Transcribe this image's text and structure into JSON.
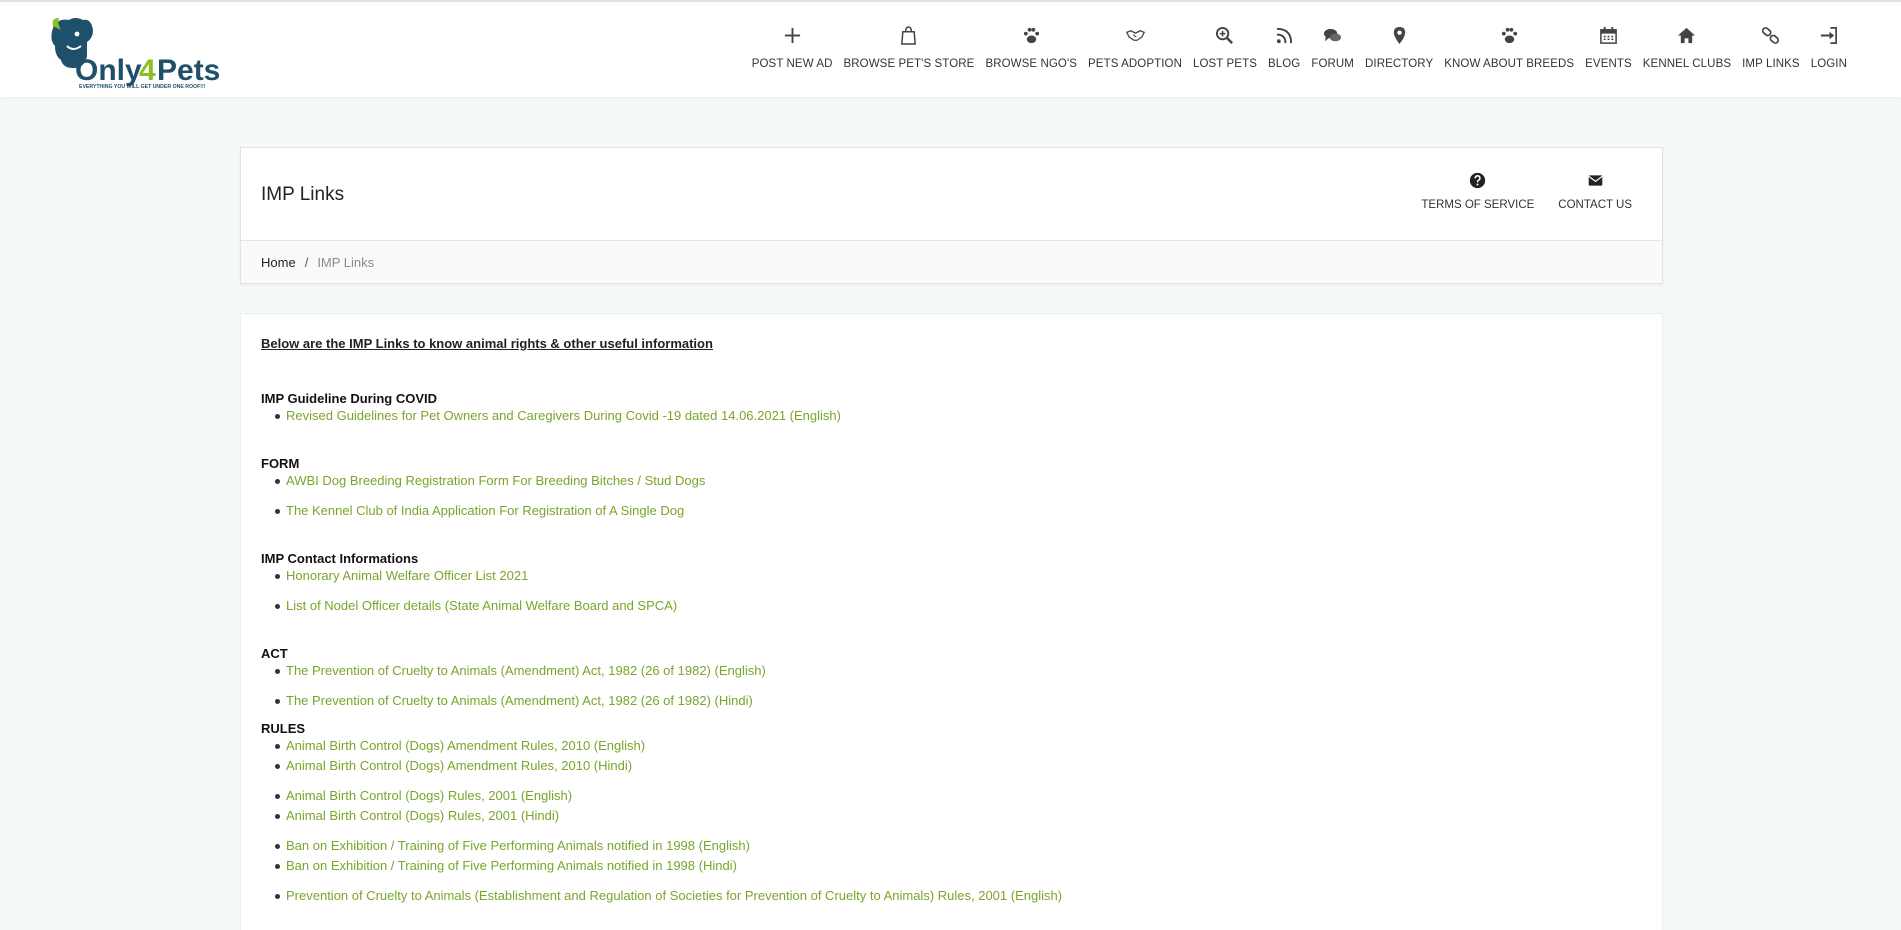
{
  "logo": {
    "brand": "Only4Pets",
    "tagline": "EVERYTHING YOU WILL GET UNDER ONE ROOF!!!"
  },
  "nav": [
    {
      "label": "POST NEW AD",
      "icon": "plus-icon"
    },
    {
      "label": "BROWSE PET'S STORE",
      "icon": "shopping-bag-icon"
    },
    {
      "label": "BROWSE NGO'S",
      "icon": "paw-icon"
    },
    {
      "label": "PETS ADOPTION",
      "icon": "handshake-icon"
    },
    {
      "label": "LOST PETS",
      "icon": "search-plus-icon"
    },
    {
      "label": "BLOG",
      "icon": "rss-icon"
    },
    {
      "label": "FORUM",
      "icon": "comments-icon"
    },
    {
      "label": "DIRECTORY",
      "icon": "map-marker-icon"
    },
    {
      "label": "KNOW ABOUT BREEDS",
      "icon": "paw-icon"
    },
    {
      "label": "EVENTS",
      "icon": "calendar-icon"
    },
    {
      "label": "KENNEL CLUBS",
      "icon": "home-icon"
    },
    {
      "label": "IMP LINKS",
      "icon": "link-icon"
    },
    {
      "label": "LOGIN",
      "icon": "sign-in-icon"
    }
  ],
  "page": {
    "title": "IMP Links",
    "terms_label": "TERMS OF SERVICE",
    "contact_label": "CONTACT US"
  },
  "breadcrumb": {
    "home": "Home",
    "separator": "/",
    "current": "IMP Links"
  },
  "content": {
    "intro": "Below are the IMP Links to know animal rights & other useful information",
    "sections": [
      {
        "title": "IMP Guideline During COVID",
        "links": [
          "Revised Guidelines for Pet Owners and Caregivers During Covid -19 dated 14.06.2021 (English)"
        ]
      },
      {
        "title": "FORM",
        "links": [
          "AWBI Dog Breeding Registration Form For Breeding Bitches / Stud Dogs",
          "The Kennel Club of India Application For Registration of A Single Dog"
        ]
      },
      {
        "title": "IMP Contact Informations",
        "links": [
          "Honorary Animal Welfare Officer List 2021",
          "List of Nodel Officer details (State Animal Welfare Board and SPCA)"
        ]
      },
      {
        "title": "ACT",
        "links": [
          "The Prevention of Cruelty to Animals (Amendment) Act, 1982 (26 of 1982) (English)",
          "The Prevention of Cruelty to Animals (Amendment) Act, 1982 (26 of 1982) (Hindi)"
        ]
      },
      {
        "title": "RULES",
        "links": [
          "Animal Birth Control (Dogs) Amendment Rules, 2010 (English)",
          "Animal Birth Control (Dogs) Amendment Rules, 2010 (Hindi)",
          "Animal Birth Control (Dogs) Rules, 2001 (English)",
          "Animal Birth Control (Dogs) Rules, 2001 (Hindi)",
          "Ban on Exhibition / Training of Five Performing Animals notified in 1998 (English)",
          "Ban on Exhibition / Training of Five Performing Animals notified in 1998 (Hindi)",
          "Prevention of Cruelty to Animals (Establishment and Regulation of Societies for Prevention of Cruelty to Animals) Rules, 2001 (English)"
        ]
      }
    ]
  },
  "colors": {
    "link": "#7aa52a",
    "logo_dark": "#1e4f6b",
    "logo_green": "#8cbf26"
  }
}
